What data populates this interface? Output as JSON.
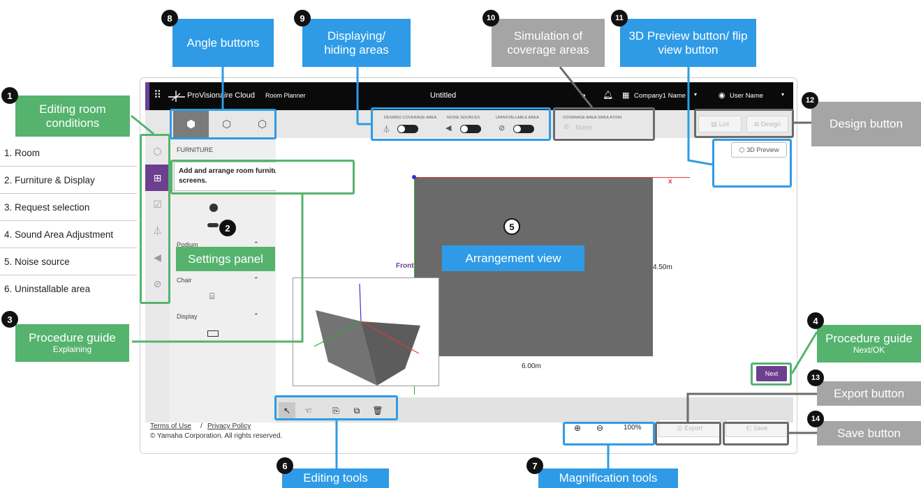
{
  "app": {
    "logo_text": "ProVisionaire Cloud",
    "product": "Room Planner",
    "document_title": "Untitled",
    "company": "Company1 Name",
    "user": "User Name"
  },
  "toolbar": {
    "toggles": [
      {
        "label": "DESIRED COVERAGE AREA",
        "icon": "area-icon"
      },
      {
        "label": "NOISE SOURCES",
        "icon": "speaker-icon"
      },
      {
        "label": "UNINSTALLABLE AREA",
        "icon": "forbidden-area-icon"
      }
    ],
    "coverage_label": "COVERAGE AREA SIMULATION",
    "coverage_value": "None",
    "list_button": "List",
    "design_button": "Design"
  },
  "settings": {
    "section": "FURNITURE",
    "guide_text": "Add and arrange room furniture and display screens.",
    "groups": [
      "Podium",
      "Chair",
      "Display"
    ]
  },
  "canvas": {
    "preview_button": "3D Preview",
    "front_label": "Front",
    "x_label": "x",
    "depth_label": "4.50m",
    "width_label": "6.00m",
    "next_button": "Next"
  },
  "bottom": {
    "zoom_value": "100%",
    "export_button": "Export",
    "save_button": "Save"
  },
  "footer": {
    "terms": "Terms of Use",
    "separator": "/",
    "privacy": "Privacy Policy",
    "copyright": "© Yamaha Corporation. All rights reserved."
  },
  "room_conditions": [
    "1. Room",
    "2. Furniture & Display",
    "3. Request selection",
    "4. Sound Area Adjustment",
    "5. Noise source",
    "6. Uninstallable area"
  ],
  "annotations": {
    "n1": "Editing room conditions",
    "n2": "Settings panel",
    "n3_title": "Procedure guide",
    "n3_sub": "Explaining",
    "n4_title": "Procedure guide",
    "n4_sub": "Next/OK",
    "n5": "Arrangement view",
    "n6": "Editing tools",
    "n7": "Magnification tools",
    "n8": "Angle buttons",
    "n9": "Displaying/ hiding areas",
    "n10": "Simulation of coverage areas",
    "n11": "3D Preview button/ flip view button",
    "n12": "Design button",
    "n13": "Export button",
    "n14": "Save button"
  },
  "badges": [
    "1",
    "2",
    "3",
    "4",
    "5",
    "6",
    "7",
    "8",
    "9",
    "10",
    "11",
    "12",
    "13",
    "14"
  ],
  "colors": {
    "accent": "#6d3f8f",
    "callout_blue": "#2f9be6",
    "callout_green": "#55b36e",
    "callout_gray": "#a5a5a5"
  }
}
